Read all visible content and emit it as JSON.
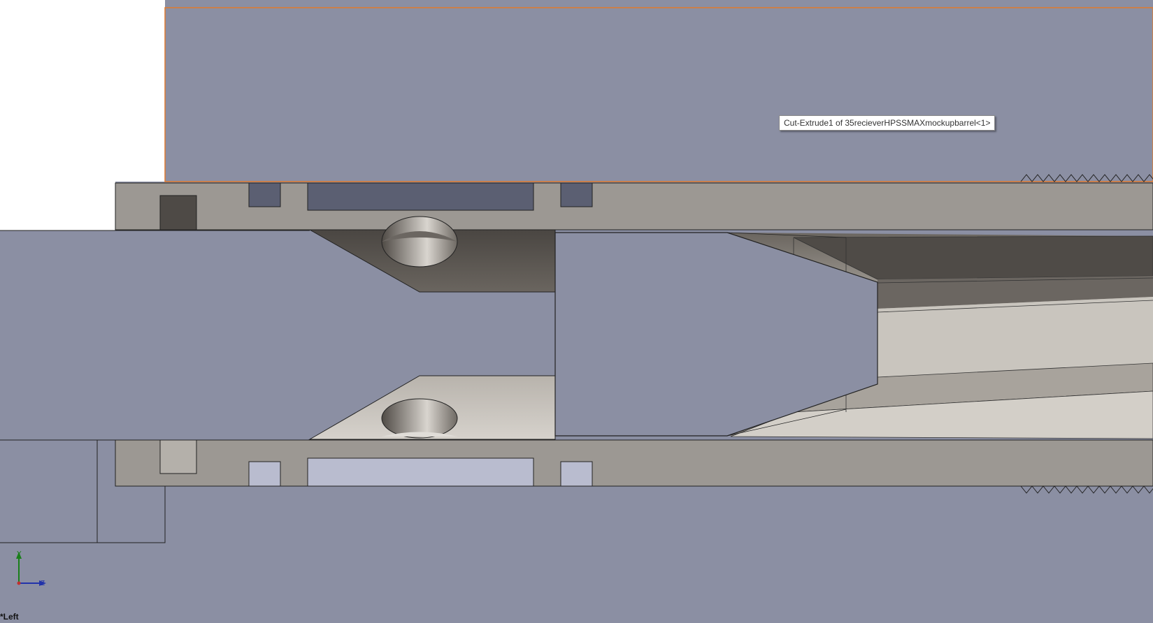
{
  "tooltip": {
    "text": "Cut-Extrude1 of 35recieverHPSSMAXmockupbarrel<1>"
  },
  "view": {
    "orientation_label": "*Left"
  },
  "triad": {
    "y_label": "Y",
    "z_label": "Z"
  },
  "colors": {
    "background_slate": "#8b8fa3",
    "section_wall": "#9c9893",
    "dark_cavity": "#4e4a46",
    "highlight_edge": "#e07a2e",
    "light_recess": "#b9bccf"
  }
}
